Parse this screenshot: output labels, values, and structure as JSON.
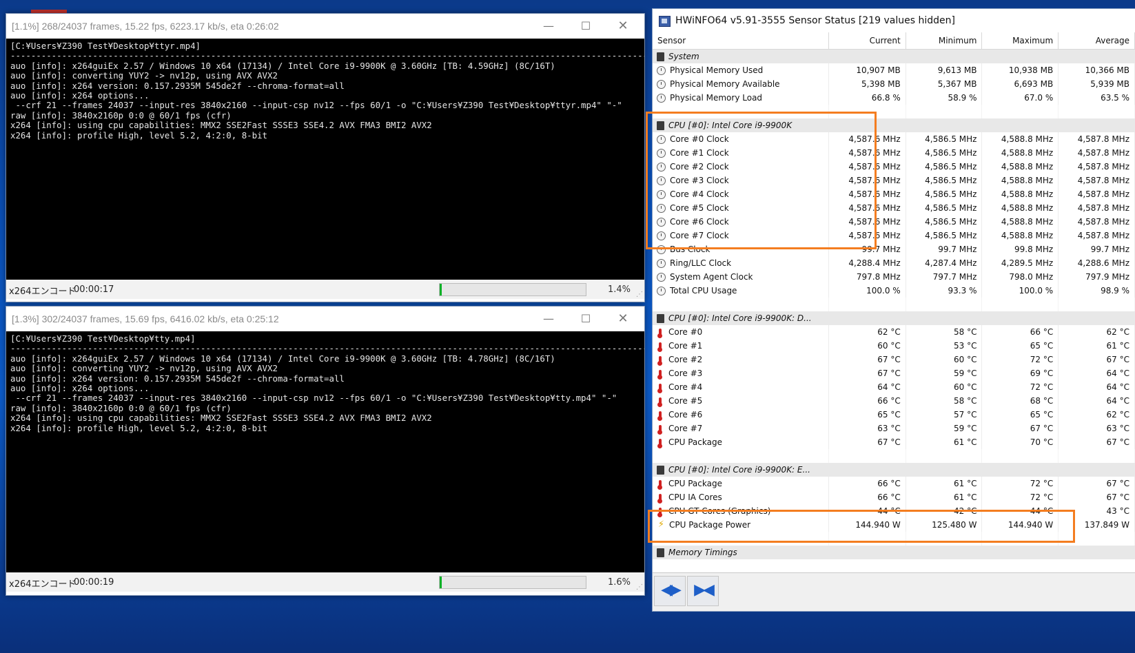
{
  "encoders": [
    {
      "title": "[1.1%] 268/24037 frames, 15.22 fps, 6223.17 kb/s, eta 0:26:02",
      "console": "[C:¥Users¥Z390 Test¥Desktop¥ttyr.mp4]\n--------------------------------------------------------------------------------------------------------------------------------\nauo [info]: x264guiEx 2.57 / Windows 10 x64 (17134) / Intel Core i9-9900K @ 3.60GHz [TB: 4.59GHz] (8C/16T)\nauo [info]: converting YUY2 -> nv12p, using AVX AVX2\nauo [info]: x264 version: 0.157.2935M 545de2f --chroma-format=all\nauo [info]: x264 options...\n --crf 21 --frames 24037 --input-res 3840x2160 --input-csp nv12 --fps 60/1 -o \"C:¥Users¥Z390 Test¥Desktop¥ttyr.mp4\" \"-\"\nraw [info]: 3840x2160p 0:0 @ 60/1 fps (cfr)\nx264 [info]: using cpu capabilities: MMX2 SSE2Fast SSSE3 SSE4.2 AVX FMA3 BMI2 AVX2\nx264 [info]: profile High, level 5.2, 4:2:0, 8-bit",
      "status_label": "x264エンコード",
      "elapsed": "00:00:17",
      "progress": 0.014,
      "progress_label": "1.4%"
    },
    {
      "title": "[1.3%] 302/24037 frames, 15.69 fps, 6416.02 kb/s, eta 0:25:12",
      "console": "[C:¥Users¥Z390 Test¥Desktop¥tty.mp4]\n--------------------------------------------------------------------------------------------------------------------------------\nauo [info]: x264guiEx 2.57 / Windows 10 x64 (17134) / Intel Core i9-9900K @ 3.60GHz [TB: 4.78GHz] (8C/16T)\nauo [info]: converting YUY2 -> nv12p, using AVX AVX2\nauo [info]: x264 version: 0.157.2935M 545de2f --chroma-format=all\nauo [info]: x264 options...\n --crf 21 --frames 24037 --input-res 3840x2160 --input-csp nv12 --fps 60/1 -o \"C:¥Users¥Z390 Test¥Desktop¥tty.mp4\" \"-\"\nraw [info]: 3840x2160p 0:0 @ 60/1 fps (cfr)\nx264 [info]: using cpu capabilities: MMX2 SSE2Fast SSSE3 SSE4.2 AVX FMA3 BMI2 AVX2\nx264 [info]: profile High, level 5.2, 4:2:0, 8-bit",
      "status_label": "x264エンコード",
      "elapsed": "00:00:19",
      "progress": 0.016,
      "progress_label": "1.6%"
    }
  ],
  "hwinfo": {
    "title": "HWiNFO64 v5.91-3555 Sensor Status [219 values hidden]",
    "columns": [
      "Sensor",
      "Current",
      "Minimum",
      "Maximum",
      "Average"
    ],
    "rows": [
      {
        "type": "group",
        "label": "System"
      },
      {
        "icon": "clock",
        "label": "Physical Memory Used",
        "vals": [
          "10,907 MB",
          "9,613 MB",
          "10,938 MB",
          "10,366 MB"
        ]
      },
      {
        "icon": "clock",
        "label": "Physical Memory Available",
        "vals": [
          "5,398 MB",
          "5,367 MB",
          "6,693 MB",
          "5,939 MB"
        ]
      },
      {
        "icon": "clock",
        "label": "Physical Memory Load",
        "vals": [
          "66.8 %",
          "58.9 %",
          "67.0 %",
          "63.5 %"
        ]
      },
      {
        "type": "blank"
      },
      {
        "type": "group",
        "label": "CPU [#0]: Intel Core i9-9900K"
      },
      {
        "icon": "clock",
        "label": "Core #0 Clock",
        "vals": [
          "4,587.6 MHz",
          "4,586.5 MHz",
          "4,588.8 MHz",
          "4,587.8 MHz"
        ]
      },
      {
        "icon": "clock",
        "label": "Core #1 Clock",
        "vals": [
          "4,587.6 MHz",
          "4,586.5 MHz",
          "4,588.8 MHz",
          "4,587.8 MHz"
        ]
      },
      {
        "icon": "clock",
        "label": "Core #2 Clock",
        "vals": [
          "4,587.6 MHz",
          "4,586.5 MHz",
          "4,588.8 MHz",
          "4,587.8 MHz"
        ]
      },
      {
        "icon": "clock",
        "label": "Core #3 Clock",
        "vals": [
          "4,587.6 MHz",
          "4,586.5 MHz",
          "4,588.8 MHz",
          "4,587.8 MHz"
        ]
      },
      {
        "icon": "clock",
        "label": "Core #4 Clock",
        "vals": [
          "4,587.6 MHz",
          "4,586.5 MHz",
          "4,588.8 MHz",
          "4,587.8 MHz"
        ]
      },
      {
        "icon": "clock",
        "label": "Core #5 Clock",
        "vals": [
          "4,587.6 MHz",
          "4,586.5 MHz",
          "4,588.8 MHz",
          "4,587.8 MHz"
        ]
      },
      {
        "icon": "clock",
        "label": "Core #6 Clock",
        "vals": [
          "4,587.6 MHz",
          "4,586.5 MHz",
          "4,588.8 MHz",
          "4,587.8 MHz"
        ]
      },
      {
        "icon": "clock",
        "label": "Core #7 Clock",
        "vals": [
          "4,587.6 MHz",
          "4,586.5 MHz",
          "4,588.8 MHz",
          "4,587.8 MHz"
        ]
      },
      {
        "icon": "clock",
        "label": "Bus Clock",
        "vals": [
          "99.7 MHz",
          "99.7 MHz",
          "99.8 MHz",
          "99.7 MHz"
        ]
      },
      {
        "icon": "clock",
        "label": "Ring/LLC Clock",
        "vals": [
          "4,288.4 MHz",
          "4,287.4 MHz",
          "4,289.5 MHz",
          "4,288.6 MHz"
        ]
      },
      {
        "icon": "clock",
        "label": "System Agent Clock",
        "vals": [
          "797.8 MHz",
          "797.7 MHz",
          "798.0 MHz",
          "797.9 MHz"
        ]
      },
      {
        "icon": "clock",
        "label": "Total CPU Usage",
        "vals": [
          "100.0 %",
          "93.3 %",
          "100.0 %",
          "98.9 %"
        ]
      },
      {
        "type": "blank"
      },
      {
        "type": "group",
        "label": "CPU [#0]: Intel Core i9-9900K: D..."
      },
      {
        "icon": "therm",
        "label": "Core #0",
        "vals": [
          "62 °C",
          "58 °C",
          "66 °C",
          "62 °C"
        ]
      },
      {
        "icon": "therm",
        "label": "Core #1",
        "vals": [
          "60 °C",
          "53 °C",
          "65 °C",
          "61 °C"
        ]
      },
      {
        "icon": "therm",
        "label": "Core #2",
        "vals": [
          "67 °C",
          "60 °C",
          "72 °C",
          "67 °C"
        ]
      },
      {
        "icon": "therm",
        "label": "Core #3",
        "vals": [
          "67 °C",
          "59 °C",
          "69 °C",
          "64 °C"
        ]
      },
      {
        "icon": "therm",
        "label": "Core #4",
        "vals": [
          "64 °C",
          "60 °C",
          "72 °C",
          "64 °C"
        ]
      },
      {
        "icon": "therm",
        "label": "Core #5",
        "vals": [
          "66 °C",
          "58 °C",
          "68 °C",
          "64 °C"
        ]
      },
      {
        "icon": "therm",
        "label": "Core #6",
        "vals": [
          "65 °C",
          "57 °C",
          "65 °C",
          "62 °C"
        ]
      },
      {
        "icon": "therm",
        "label": "Core #7",
        "vals": [
          "63 °C",
          "59 °C",
          "67 °C",
          "63 °C"
        ]
      },
      {
        "icon": "therm",
        "label": "CPU Package",
        "vals": [
          "67 °C",
          "61 °C",
          "70 °C",
          "67 °C"
        ]
      },
      {
        "type": "blank"
      },
      {
        "type": "group",
        "label": "CPU [#0]: Intel Core i9-9900K: E..."
      },
      {
        "icon": "therm",
        "label": "CPU Package",
        "vals": [
          "66 °C",
          "61 °C",
          "72 °C",
          "67 °C"
        ]
      },
      {
        "icon": "therm",
        "label": "CPU IA Cores",
        "vals": [
          "66 °C",
          "61 °C",
          "72 °C",
          "67 °C"
        ]
      },
      {
        "icon": "therm",
        "label": "CPU GT Cores (Graphics)",
        "vals": [
          "44 °C",
          "42 °C",
          "44 °C",
          "43 °C"
        ]
      },
      {
        "icon": "bolt",
        "label": "CPU Package Power",
        "vals": [
          "144.940 W",
          "125.480 W",
          "144.940 W",
          "137.849 W"
        ]
      },
      {
        "type": "blank"
      },
      {
        "type": "group",
        "label": "Memory Timings"
      }
    ],
    "nav_left": "◀▶",
    "nav_right": "▶◀"
  },
  "colors": {
    "highlight": "#f47d20",
    "progress": "#06b025",
    "desktop": "#0a4fb5"
  }
}
